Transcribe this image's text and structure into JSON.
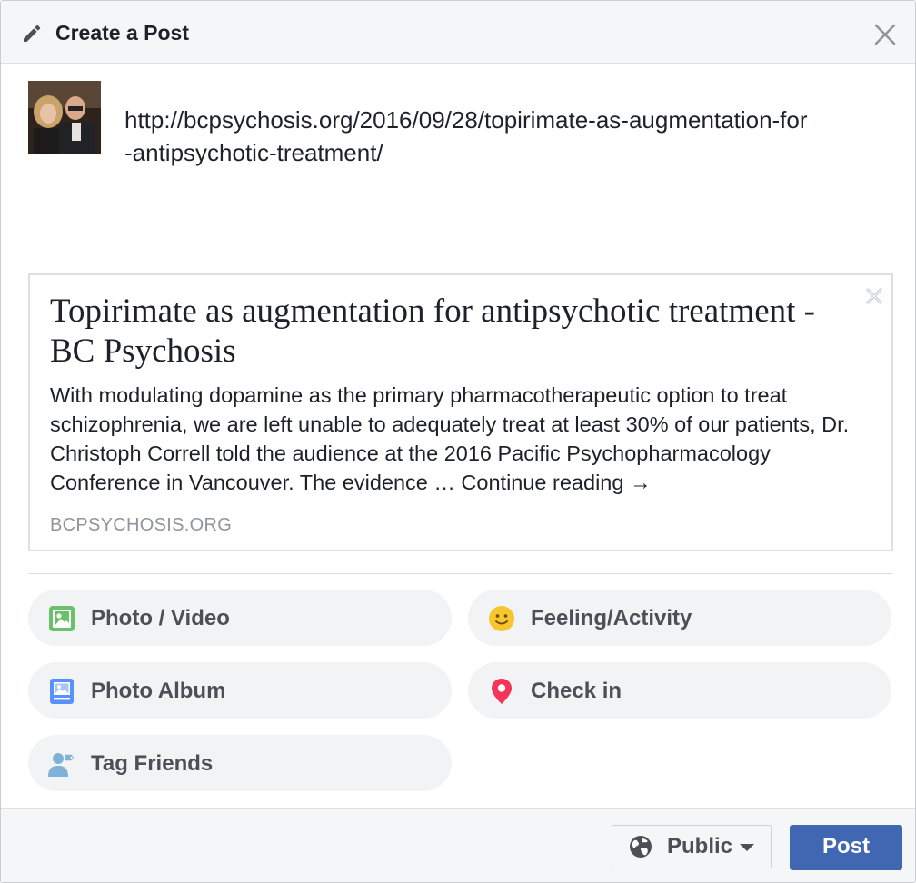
{
  "header": {
    "title": "Create a Post",
    "icon": "pencil-icon",
    "close_icon": "close-icon"
  },
  "composer": {
    "text": "http://bcpsychosis.org/2016/09/28/topirimate-as-augmentation-for-antipsychotic-treatment/"
  },
  "link_preview": {
    "title": "Topirimate as augmentation for antipsychotic treatment - BC Psychosis",
    "description": "With modulating dopamine as the primary pharmacotherapeutic option to treat schizophrenia, we are left unable to adequately treat at least 30% of our patients, Dr. Christoph Correll told the audience at the 2016 Pacific Psychopharmacology Conference in Vancouver. The evidence … Continue reading →",
    "domain": "BCPSYCHOSIS.ORG"
  },
  "actions": [
    {
      "label": "Photo / Video",
      "icon": "photo-video-icon",
      "color": "#6bc16b"
    },
    {
      "label": "Feeling/Activity",
      "icon": "smiley-icon",
      "color": "#f7c52d"
    },
    {
      "label": "Photo Album",
      "icon": "photo-album-icon",
      "color": "#5890ff"
    },
    {
      "label": "Check in",
      "icon": "location-pin-icon",
      "color": "#f5335b"
    },
    {
      "label": "Tag Friends",
      "icon": "tag-friends-icon",
      "color": "#7fb2d9"
    }
  ],
  "footer": {
    "privacy_label": "Public",
    "privacy_icon": "globe-icon",
    "post_label": "Post"
  },
  "colors": {
    "brand_blue": "#4267b2",
    "panel_gray": "#f5f6f7",
    "pill_gray": "#f2f3f5"
  }
}
